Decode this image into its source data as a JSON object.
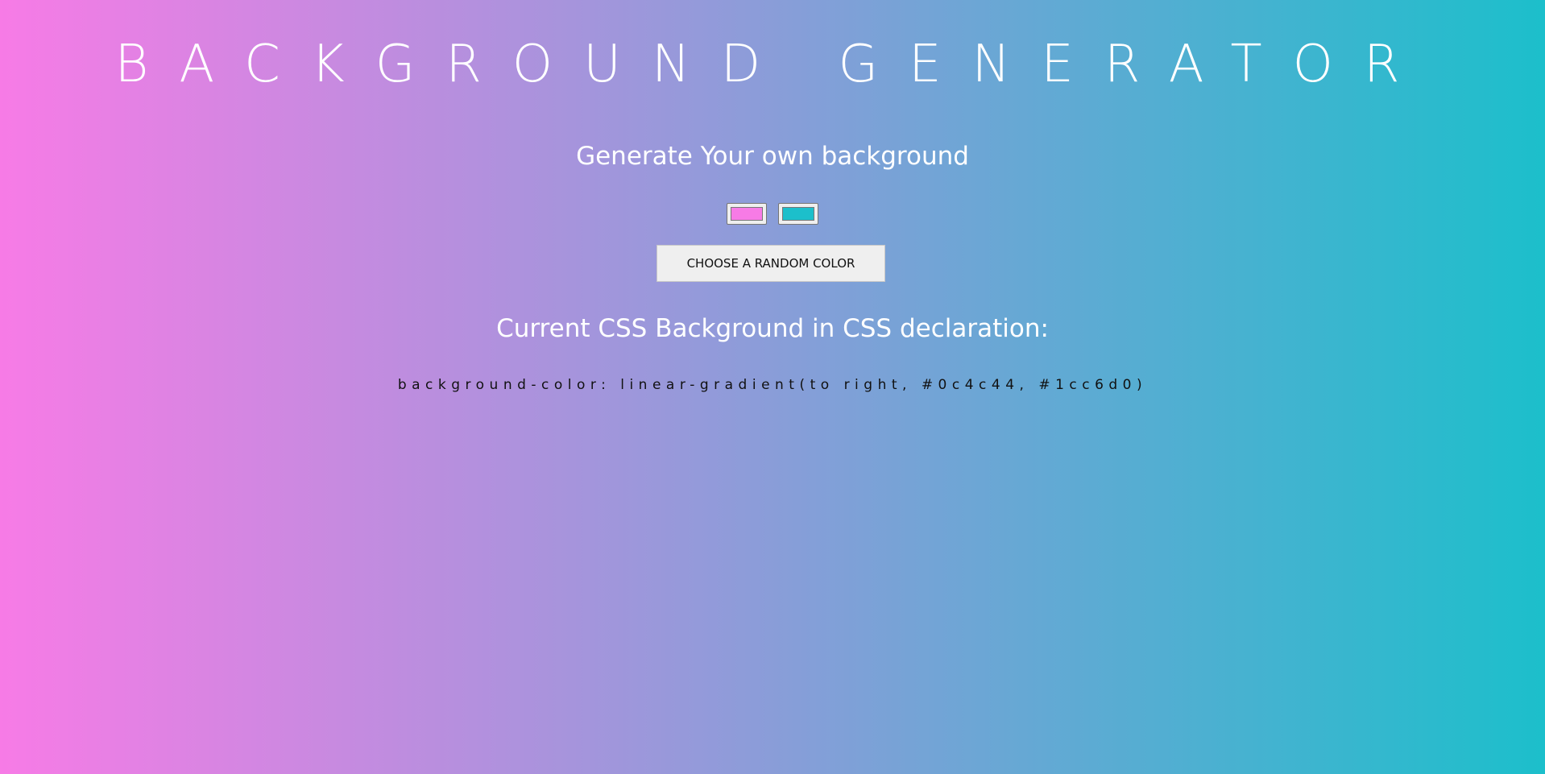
{
  "page": {
    "title": "BACKGROUND GENERATOR",
    "subtitle": "Generate Your own background"
  },
  "controls": {
    "color1": "#f77be6",
    "color2": "#1cbfcb",
    "random_button_label": "Choose a random color"
  },
  "output": {
    "heading": "Current CSS Background in CSS declaration:",
    "css_text": "background-color: linear-gradient(to right, #0c4c44, #1cc6d0)"
  },
  "colors": {
    "gradient_start": "#f77be6",
    "gradient_end": "#1cbfcb",
    "text_light": "#ffffff",
    "text_dark": "#111111"
  }
}
